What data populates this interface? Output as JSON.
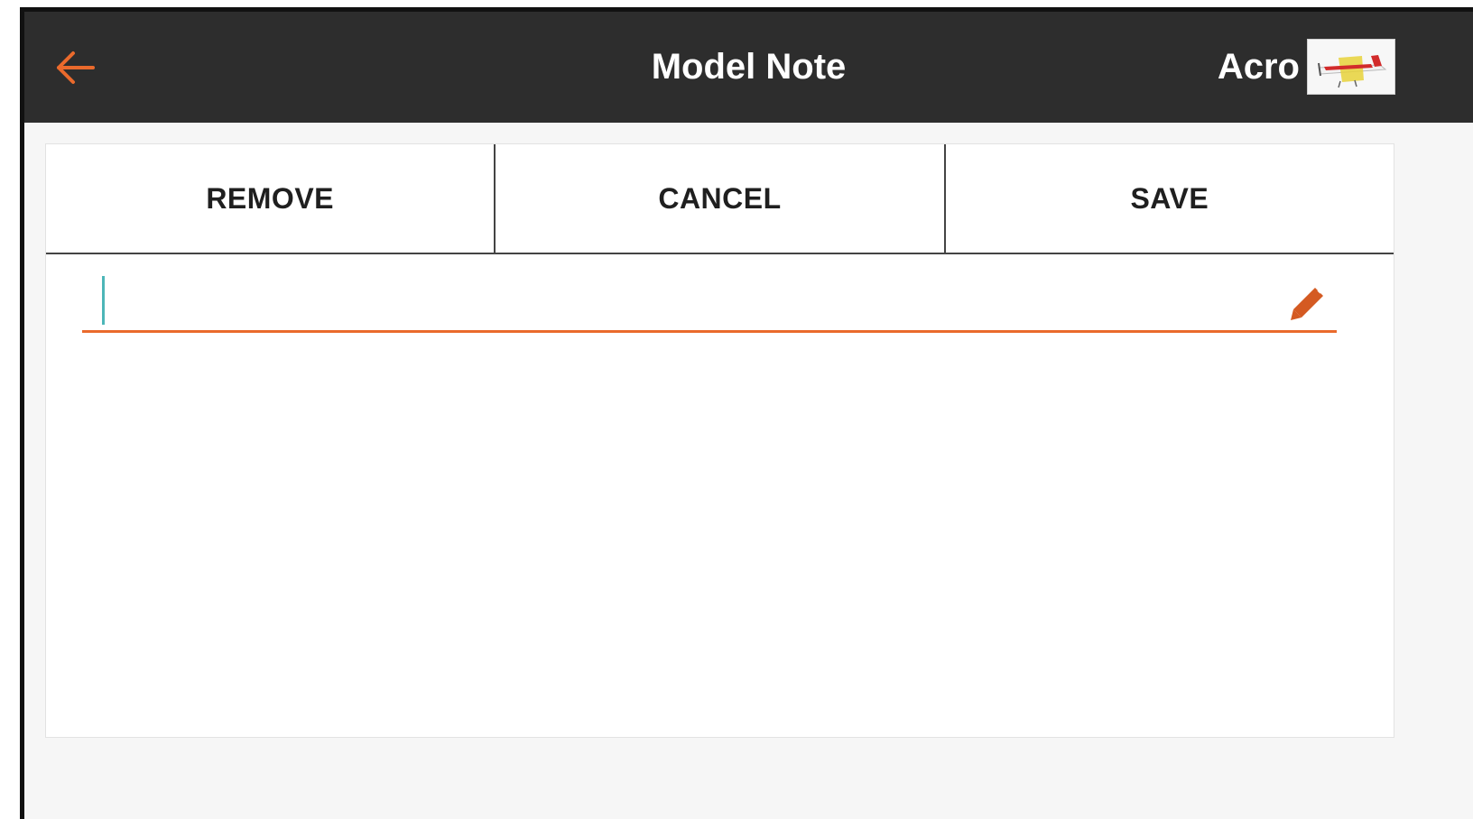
{
  "header": {
    "title": "Model Note",
    "model_name": "Acro",
    "back_icon": "arrow-left-icon",
    "model_thumbnail": "airplane-model-icon"
  },
  "actions": {
    "remove_label": "REMOVE",
    "cancel_label": "CANCEL",
    "save_label": "SAVE"
  },
  "note": {
    "value": "",
    "edit_icon": "pencil-icon"
  },
  "colors": {
    "accent": "#ea6a2c",
    "header_bg": "#2d2d2d",
    "caret": "#4db6b8"
  }
}
